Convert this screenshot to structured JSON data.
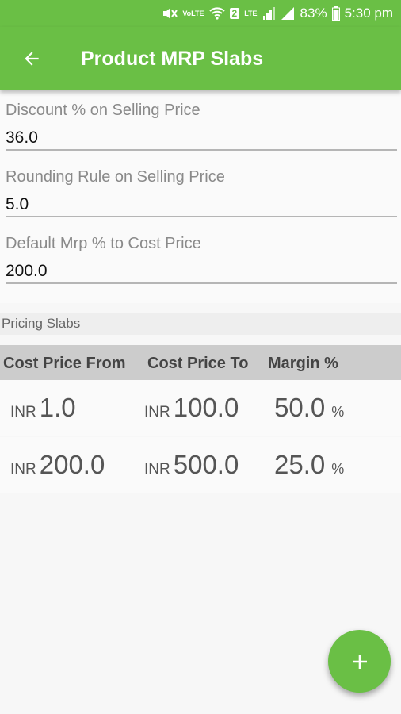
{
  "status_bar": {
    "network_label": "VoLTE",
    "sim_label": "2",
    "lte_label": "LTE",
    "battery_pct": "83%",
    "time": "5:30 pm",
    "icons": [
      "mute-icon",
      "wifi-icon",
      "signal-icon",
      "battery-icon"
    ]
  },
  "app_bar": {
    "title": "Product MRP Slabs",
    "back_icon": "arrow-left-icon",
    "color": "#6abf45"
  },
  "fields": [
    {
      "label": "Discount % on Selling Price",
      "value": "36.0"
    },
    {
      "label": "Rounding Rule on Selling Price",
      "value": "5.0"
    },
    {
      "label": "Default Mrp % to Cost Price",
      "value": "200.0"
    }
  ],
  "slabs": {
    "section_title": "Pricing Slabs",
    "columns": [
      "Cost Price From",
      "Cost Price To",
      "Margin %"
    ],
    "currency": "INR",
    "percent_symbol": "%",
    "rows": [
      {
        "from": "1.0",
        "to": "100.0",
        "margin": "50.0"
      },
      {
        "from": "200.0",
        "to": "500.0",
        "margin": "25.0"
      }
    ]
  },
  "fab": {
    "icon": "plus-icon"
  }
}
